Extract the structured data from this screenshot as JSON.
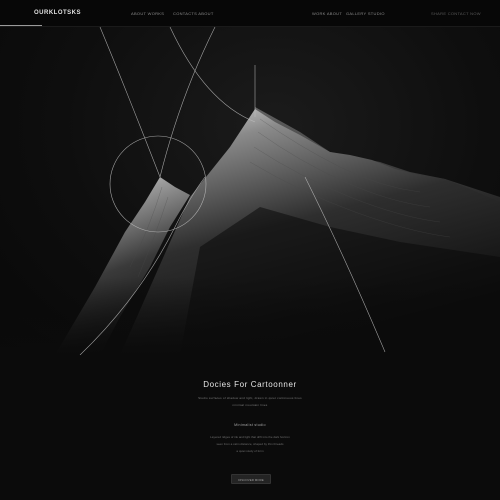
{
  "header": {
    "brand": "OURKLOTSKS",
    "nav": [
      {
        "label": "ABOUT WORKS"
      },
      {
        "label": "CONTACTS ABOUT"
      },
      {
        "label": "WORK ABOUT"
      },
      {
        "label": "GALLERY STUDIO"
      },
      {
        "label": "SHARE CONTACT NOW"
      }
    ]
  },
  "content": {
    "title": "Docies For Cartoonner",
    "subtitle_lines": [
      "Studio surfaces of shadow and light, drawn in quiet continuous lines",
      "minimal mountain lines"
    ],
    "section_title": "Minimalist studio",
    "paragraph_lines": [
      "Layered ridges of ink and light that drift into the dark horizon",
      "seen from a calm distance, shaped by thin threads",
      "a quiet study of form"
    ],
    "cta_label": "DISCOVER MORE"
  },
  "colors": {
    "background": "#0b0b0b",
    "accent": "#e6e6e6"
  }
}
